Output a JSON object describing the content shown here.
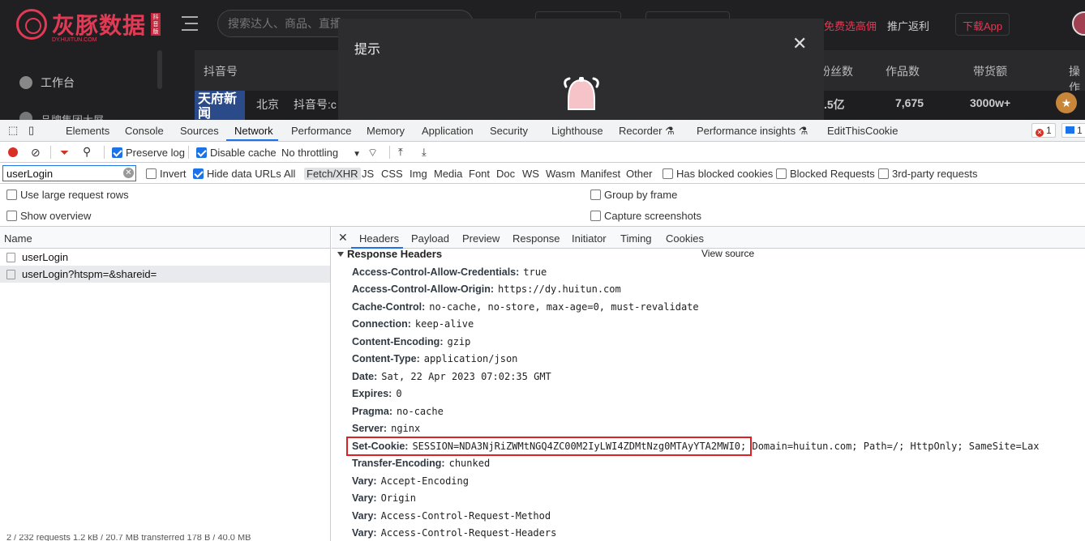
{
  "site": {
    "brand": "灰豚数据",
    "brand_sub": "DY.HUITUN.COM",
    "seal": "抖音版",
    "search_placeholder": "搜索达人、商品、直播",
    "header_links": [
      "免费选高佣",
      "推广返利",
      "下载App"
    ],
    "nav_workspace": "工作台",
    "nav_next": "品牌集团大屏",
    "table_columns": [
      "抖音号",
      "粉丝数",
      "作品数",
      "带货额",
      "操作"
    ],
    "row": {
      "thumb_text": "天府新闻",
      "location": "北京",
      "douyin_prefix": "抖音号:c",
      "fans": ".5亿",
      "works": "7,675",
      "sales": "3000w+"
    }
  },
  "modal": {
    "title": "提示",
    "close": "✕"
  },
  "devtools": {
    "tabs": [
      "Elements",
      "Console",
      "Sources",
      "Network",
      "Performance",
      "Memory",
      "Application",
      "Security",
      "Lighthouse",
      "Recorder ⚗",
      "Performance insights ⚗",
      "EditThisCookie"
    ],
    "active_tab": "Network",
    "errors": "1",
    "messages": "1",
    "toolbar": {
      "preserve_log": "Preserve log",
      "disable_cache": "Disable cache",
      "throttling": "No throttling"
    },
    "filter": {
      "value": "userLogin",
      "invert": "Invert",
      "hide_data_urls": "Hide data URLs",
      "types": [
        "All",
        "Fetch/XHR",
        "JS",
        "CSS",
        "Img",
        "Media",
        "Font",
        "Doc",
        "WS",
        "Wasm",
        "Manifest",
        "Other"
      ],
      "selected_type": "Fetch/XHR",
      "has_blocked_cookies": "Has blocked cookies",
      "blocked_requests": "Blocked Requests",
      "third_party": "3rd-party requests"
    },
    "options": {
      "large_rows": "Use large request rows",
      "group_by_frame": "Group by frame",
      "show_overview": "Show overview",
      "capture_screenshots": "Capture screenshots"
    },
    "name_header": "Name",
    "requests": [
      "userLogin",
      "userLogin?htspm=&shareid="
    ],
    "status_bar": "2 / 232 requests   1.2 kB / 20.7 MB transferred   178 B / 40.0 MB",
    "detail_tabs": [
      "Headers",
      "Payload",
      "Preview",
      "Response",
      "Initiator",
      "Timing",
      "Cookies"
    ],
    "active_detail_tab": "Headers",
    "section_title": "Response Headers",
    "view_source": "View source",
    "headers": [
      {
        "k": "Access-Control-Allow-Credentials:",
        "v": "true"
      },
      {
        "k": "Access-Control-Allow-Origin:",
        "v": "https://dy.huitun.com"
      },
      {
        "k": "Cache-Control:",
        "v": "no-cache, no-store, max-age=0, must-revalidate"
      },
      {
        "k": "Connection:",
        "v": "keep-alive"
      },
      {
        "k": "Content-Encoding:",
        "v": "gzip"
      },
      {
        "k": "Content-Type:",
        "v": "application/json"
      },
      {
        "k": "Date:",
        "v": "Sat, 22 Apr 2023 07:02:35 GMT"
      },
      {
        "k": "Expires:",
        "v": "0"
      },
      {
        "k": "Pragma:",
        "v": "no-cache"
      },
      {
        "k": "Server:",
        "v": "nginx"
      },
      {
        "k": "Set-Cookie:",
        "v": "SESSION=NDA3NjRiZWMtNGQ4ZC00M2IyLWI4ZDMtNzg0MTAyYTA2MWI0; Domain=huitun.com; Path=/; HttpOnly; SameSite=Lax"
      },
      {
        "k": "Transfer-Encoding:",
        "v": "chunked"
      },
      {
        "k": "Vary:",
        "v": "Accept-Encoding"
      },
      {
        "k": "Vary:",
        "v": "Origin"
      },
      {
        "k": "Vary:",
        "v": "Access-Control-Request-Method"
      },
      {
        "k": "Vary:",
        "v": "Access-Control-Request-Headers"
      }
    ]
  }
}
